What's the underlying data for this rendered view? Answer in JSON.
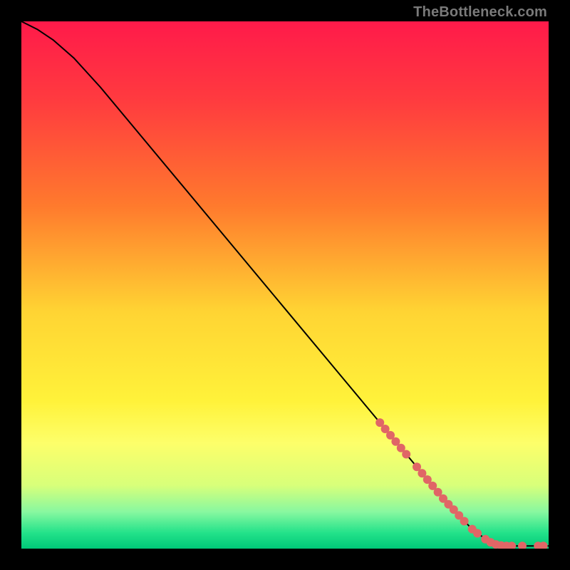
{
  "watermark": "TheBottleneck.com",
  "gradient_stops": [
    {
      "pos": 0,
      "color": "#ff1a4a"
    },
    {
      "pos": 15,
      "color": "#ff3b3f"
    },
    {
      "pos": 35,
      "color": "#ff7a2d"
    },
    {
      "pos": 55,
      "color": "#ffd433"
    },
    {
      "pos": 72,
      "color": "#fff23a"
    },
    {
      "pos": 80,
      "color": "#fdff6a"
    },
    {
      "pos": 88,
      "color": "#d8ff7a"
    },
    {
      "pos": 93,
      "color": "#88f8a0"
    },
    {
      "pos": 97,
      "color": "#23e28a"
    },
    {
      "pos": 100,
      "color": "#00c878"
    }
  ],
  "chart_data": {
    "type": "line",
    "title": "",
    "xlabel": "",
    "ylabel": "",
    "x_range": [
      0,
      100
    ],
    "y_range": [
      0,
      100
    ],
    "grid": false,
    "legend": false,
    "series": [
      {
        "name": "curve",
        "color": "#000000",
        "stroke_width": 2,
        "points": [
          {
            "x": 0,
            "y": 100
          },
          {
            "x": 3,
            "y": 98.5
          },
          {
            "x": 6,
            "y": 96.5
          },
          {
            "x": 10,
            "y": 93
          },
          {
            "x": 15,
            "y": 87.5
          },
          {
            "x": 20,
            "y": 81.5
          },
          {
            "x": 30,
            "y": 69.5
          },
          {
            "x": 40,
            "y": 57.5
          },
          {
            "x": 50,
            "y": 45.5
          },
          {
            "x": 60,
            "y": 33.5
          },
          {
            "x": 70,
            "y": 21.5
          },
          {
            "x": 75,
            "y": 15.5
          },
          {
            "x": 80,
            "y": 9.5
          },
          {
            "x": 85,
            "y": 4.2
          },
          {
            "x": 88,
            "y": 1.8
          },
          {
            "x": 90,
            "y": 0.8
          },
          {
            "x": 92,
            "y": 0.5
          },
          {
            "x": 100,
            "y": 0.5
          }
        ]
      }
    ],
    "markers": {
      "name": "highlight-dots",
      "color": "#e06666",
      "radius": 6,
      "points": [
        {
          "x": 68,
          "y": 23.9
        },
        {
          "x": 69,
          "y": 22.7
        },
        {
          "x": 70,
          "y": 21.5
        },
        {
          "x": 71,
          "y": 20.3
        },
        {
          "x": 72,
          "y": 19.1
        },
        {
          "x": 73,
          "y": 17.9
        },
        {
          "x": 75,
          "y": 15.5
        },
        {
          "x": 76,
          "y": 14.3
        },
        {
          "x": 77,
          "y": 13.1
        },
        {
          "x": 78,
          "y": 11.9
        },
        {
          "x": 79,
          "y": 10.7
        },
        {
          "x": 80,
          "y": 9.5
        },
        {
          "x": 81,
          "y": 8.4
        },
        {
          "x": 82,
          "y": 7.4
        },
        {
          "x": 83,
          "y": 6.3
        },
        {
          "x": 84,
          "y": 5.2
        },
        {
          "x": 85.5,
          "y": 3.7
        },
        {
          "x": 86.5,
          "y": 2.9
        },
        {
          "x": 88,
          "y": 1.8
        },
        {
          "x": 89,
          "y": 1.2
        },
        {
          "x": 90,
          "y": 0.8
        },
        {
          "x": 91,
          "y": 0.6
        },
        {
          "x": 92,
          "y": 0.5
        },
        {
          "x": 93,
          "y": 0.5
        },
        {
          "x": 95,
          "y": 0.5
        },
        {
          "x": 98,
          "y": 0.5
        },
        {
          "x": 99,
          "y": 0.5
        }
      ]
    }
  }
}
